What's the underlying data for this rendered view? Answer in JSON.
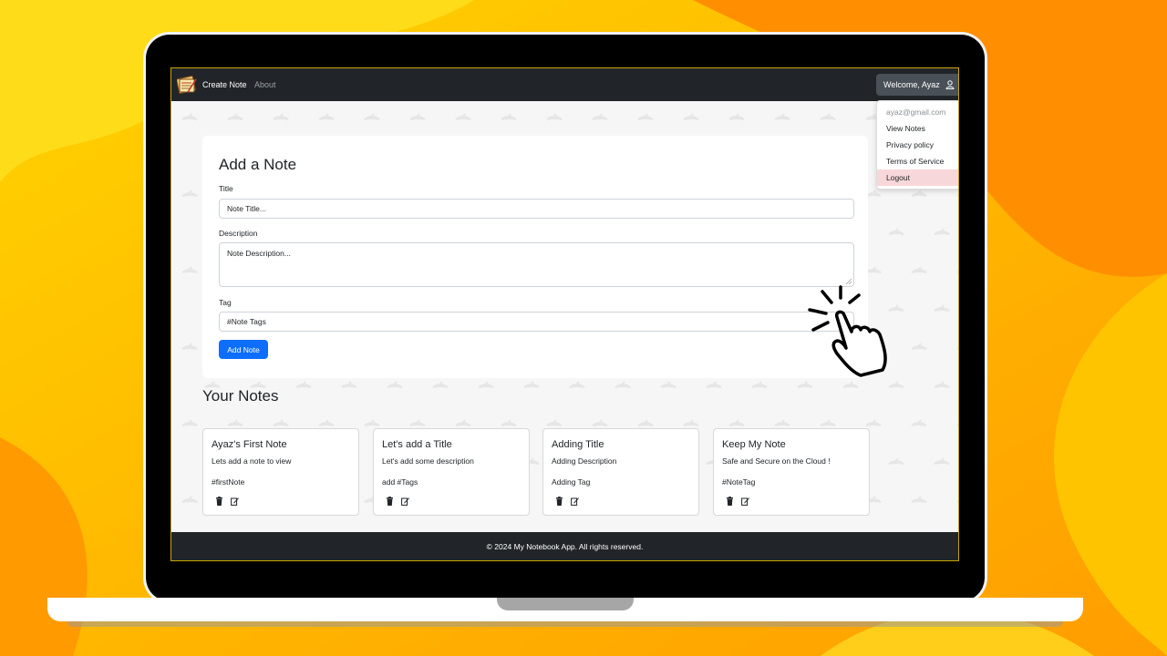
{
  "colors": {
    "background": "#ffb000",
    "navbar": "#212529",
    "primary": "#0d6efd",
    "danger_bg": "#f8d7da"
  },
  "navbar": {
    "logo_icon": "notepad-icon",
    "links": [
      {
        "label": "Create Note"
      },
      {
        "label": "About"
      }
    ],
    "user_button": {
      "label": "Welcome, Ayaz",
      "icon": "user-icon"
    },
    "dropdown": {
      "email": "ayaz@gmail.com",
      "items": [
        {
          "label": "View Notes"
        },
        {
          "label": "Privacy policy"
        },
        {
          "label": "Terms of Service"
        },
        {
          "label": "Logout"
        }
      ]
    }
  },
  "form": {
    "heading": "Add a Note",
    "title_label": "Title",
    "title_placeholder": "Note Title...",
    "description_label": "Description",
    "description_placeholder": "Note Description...",
    "tag_label": "Tag",
    "tag_placeholder": "#Note Tags",
    "submit_label": "Add Note"
  },
  "notes_section": {
    "heading": "Your Notes",
    "notes": [
      {
        "title": "Ayaz's First Note",
        "description": "Lets add a note to view",
        "tag": "#firstNote"
      },
      {
        "title": "Let's add a Title",
        "description": "Let's add some description",
        "tag": "add #Tags"
      },
      {
        "title": "Adding Title",
        "description": "Adding Description",
        "tag": "Adding Tag"
      },
      {
        "title": "Keep My Note",
        "description": "Safe and Secure on the Cloud !",
        "tag": "#NoteTag"
      }
    ]
  },
  "footer": {
    "text": "© 2024 My Notebook App. All rights reserved."
  },
  "overlay": {
    "icon": "pointing-hand-click-icon"
  }
}
